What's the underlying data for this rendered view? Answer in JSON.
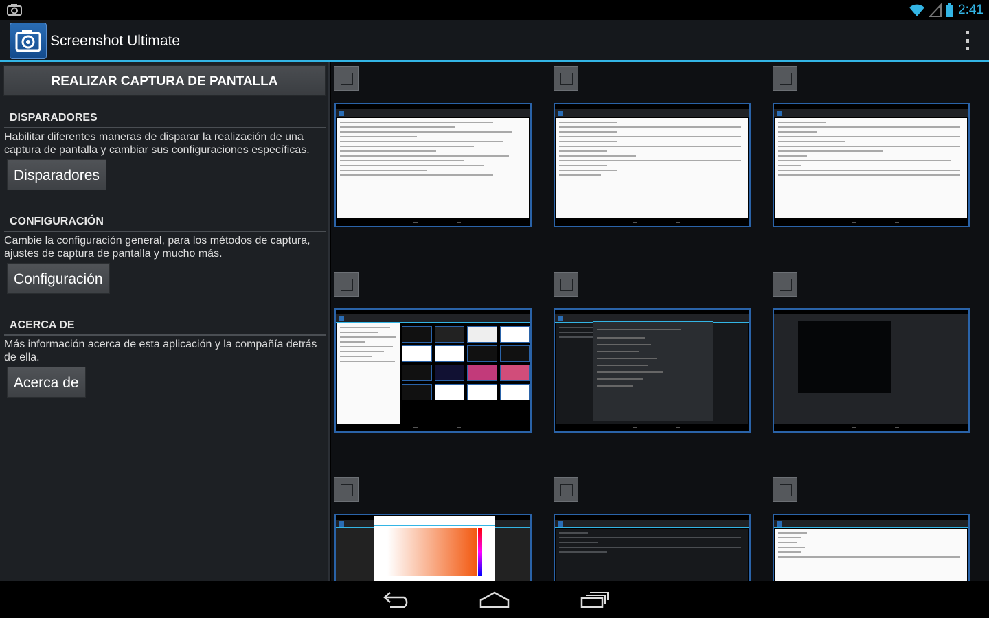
{
  "statusbar": {
    "time": "2:41",
    "icons": [
      "camera-icon",
      "wifi-icon",
      "signal-icon",
      "battery-icon"
    ]
  },
  "actionbar": {
    "title": "Screenshot Ultimate",
    "icon": "camera-icon",
    "overflow_icon": "overflow-menu-icon"
  },
  "capture_button": "REALIZAR CAPTURA DE PANTALLA",
  "sections": [
    {
      "heading": "DISPARADORES",
      "description": "Habilitar diferentes maneras de disparar la realización de una captura de pantalla y cambiar sus configuraciones específicas.",
      "button": "Disparadores"
    },
    {
      "heading": "CONFIGURACIÓN",
      "description": "Cambie la configuración general, para los métodos de captura, ajustes de captura de pantalla y mucho más.",
      "button": "Configuración"
    },
    {
      "heading": "ACERCA DE",
      "description": "Más información acerca de esta aplicación y la compañía detrás de ella.",
      "button": "Acerca de"
    }
  ],
  "thumbnails": [
    {
      "style": "light-settings",
      "checked": false
    },
    {
      "style": "light-settings",
      "checked": false
    },
    {
      "style": "light-settings",
      "checked": false
    },
    {
      "style": "gallery",
      "checked": false
    },
    {
      "style": "dark-dialog",
      "checked": false
    },
    {
      "style": "dark-launcher",
      "checked": false
    },
    {
      "style": "color-picker",
      "checked": false
    },
    {
      "style": "dark-settings",
      "checked": false
    },
    {
      "style": "light-settings",
      "checked": false
    }
  ],
  "navbar": {
    "icons": [
      "back-icon",
      "home-icon",
      "recents-icon"
    ]
  },
  "colors": {
    "accent": "#33b5e5",
    "panel": "#1d2024",
    "grid": "#0e1013",
    "thumb_border": "#2a63a8"
  }
}
